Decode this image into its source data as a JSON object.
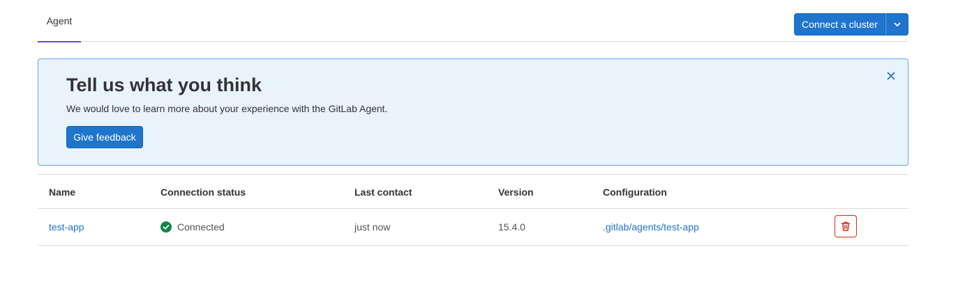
{
  "tabs": [
    {
      "label": "Agent",
      "active": true
    }
  ],
  "actions": {
    "connect_cluster_label": "Connect a cluster",
    "dropdown_icon": "chevron-down-icon"
  },
  "banner": {
    "title": "Tell us what you think",
    "text": "We would love to learn more about your experience with the GitLab Agent.",
    "button_label": "Give feedback",
    "close_icon": "close-icon"
  },
  "table": {
    "headers": [
      "Name",
      "Connection status",
      "Last contact",
      "Version",
      "Configuration"
    ],
    "rows": [
      {
        "name": "test-app",
        "status": "Connected",
        "status_icon": "check-circle-icon",
        "last_contact": "just now",
        "version": "15.4.0",
        "configuration": ".gitlab/agents/test-app",
        "action_icon": "trash-icon"
      }
    ]
  },
  "colors": {
    "primary": "#1f75cb",
    "banner_bg": "#e9f3fc",
    "banner_border": "#63a6e9",
    "success": "#108548",
    "danger": "#dd2b0e",
    "tab_indicator": "#6e49cb"
  }
}
